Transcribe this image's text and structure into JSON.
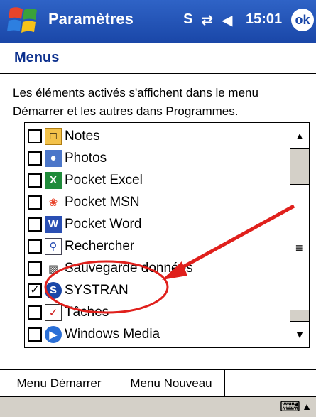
{
  "titlebar": {
    "title": "Paramètres",
    "time": "15:01",
    "ok_label": "ok",
    "status_icons": [
      "sync-icon",
      "connectivity-icon",
      "volume-icon"
    ]
  },
  "page": {
    "title": "Menus",
    "description": "Les éléments activés s'affichent dans le menu Démarrer et les autres dans Programmes."
  },
  "list": {
    "items": [
      {
        "label": "Notes",
        "checked": false,
        "icon": "notes-icon"
      },
      {
        "label": "Photos",
        "checked": false,
        "icon": "photos-icon"
      },
      {
        "label": "Pocket Excel",
        "checked": false,
        "icon": "excel-icon"
      },
      {
        "label": "Pocket MSN",
        "checked": false,
        "icon": "msn-icon"
      },
      {
        "label": "Pocket Word",
        "checked": false,
        "icon": "word-icon"
      },
      {
        "label": "Rechercher",
        "checked": false,
        "icon": "search-icon"
      },
      {
        "label": "Sauvegarde données",
        "checked": false,
        "icon": "backup-icon"
      },
      {
        "label": "SYSTRAN",
        "checked": true,
        "icon": "systran-icon"
      },
      {
        "label": "Tâches",
        "checked": false,
        "icon": "tasks-icon"
      },
      {
        "label": "Windows Media",
        "checked": false,
        "icon": "windows-media-icon"
      }
    ]
  },
  "tabs": [
    {
      "label": "Menu Démarrer",
      "active": true
    },
    {
      "label": "Menu Nouveau",
      "active": false
    }
  ],
  "colors": {
    "titlebar": "#1a47a8",
    "page_title": "#0b2f8d",
    "annotation": "#e0201c"
  }
}
